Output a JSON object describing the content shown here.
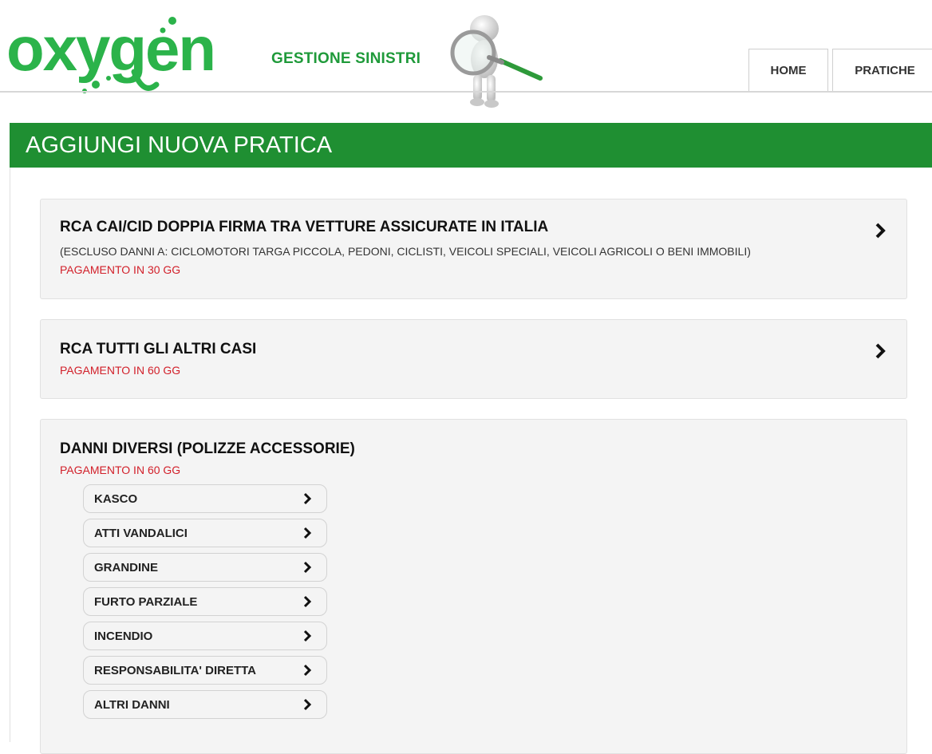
{
  "header": {
    "logo_text": "oxygen",
    "subtitle": "GESTIONE SINISTRI",
    "nav": [
      {
        "label": "HOME"
      },
      {
        "label": "PRATICHE"
      }
    ]
  },
  "page": {
    "title": "AGGIUNGI NUOVA PRATICA"
  },
  "cards": [
    {
      "title": "RCA CAI/CID DOPPIA FIRMA TRA VETTURE ASSICURATE IN ITALIA",
      "note": "(ESCLUSO DANNI A: CICLOMOTORI TARGA PICCOLA, PEDONI, CICLISTI, VEICOLI SPECIALI, VEICOLI AGRICOLI O BENI IMMOBILI)",
      "payment": "PAGAMENTO IN 30 GG"
    },
    {
      "title": "RCA TUTTI GLI ALTRI CASI",
      "payment": "PAGAMENTO IN 60 GG"
    },
    {
      "title": "DANNI DIVERSI (POLIZZE ACCESSORIE)",
      "payment": "PAGAMENTO IN 60 GG",
      "options": [
        {
          "label": "KASCO"
        },
        {
          "label": "ATTI VANDALICI"
        },
        {
          "label": "GRANDINE"
        },
        {
          "label": "FURTO PARZIALE"
        },
        {
          "label": "INCENDIO"
        },
        {
          "label": "RESPONSABILITA' DIRETTA"
        },
        {
          "label": "ALTRI DANNI"
        }
      ]
    }
  ],
  "colors": {
    "brand_green": "#1f8f32",
    "logo_green": "#2bb34a",
    "payment_red": "#d2202a"
  },
  "icons": {
    "card_action": "chevron-right-icon",
    "mascot": "magnifier-mascot-icon"
  }
}
